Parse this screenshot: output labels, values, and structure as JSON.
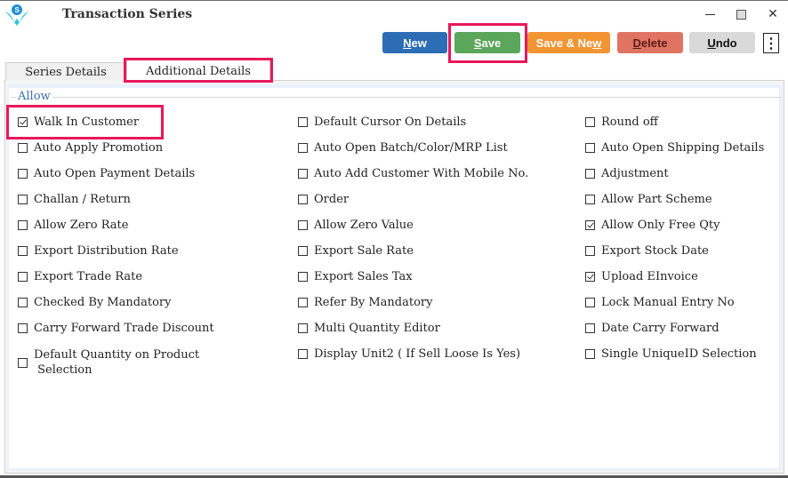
{
  "window": {
    "title": "Transaction Series",
    "controls": {
      "minimize": "—",
      "maximize": "☐",
      "close": "✕"
    }
  },
  "toolbar": {
    "new_label": "New",
    "new_accel": "N",
    "new_rest": "ew",
    "save_label": "Save",
    "save_accel": "S",
    "save_rest": "ave",
    "save_new_label": "Save & New",
    "save_new_prefix": "Save & Ne",
    "save_new_accel": "w",
    "delete_label": "Delete",
    "delete_accel": "D",
    "delete_rest": "elete",
    "undo_label": "Undo",
    "undo_accel": "U",
    "undo_rest": "ndo",
    "more_icon": "⋮",
    "colors": {
      "new": "#2d6db5",
      "save": "#5aa65a",
      "save_new": "#f39433",
      "delete": "#e07462",
      "undo": "#d9d9d9",
      "highlight": "#e8185a"
    }
  },
  "tabs": [
    {
      "label": "Series Details",
      "active": false
    },
    {
      "label": "Additional Details",
      "active": true
    }
  ],
  "group": {
    "legend": "Allow"
  },
  "options": {
    "col1": [
      {
        "label": "Walk In Customer",
        "checked": true
      },
      {
        "label": "Auto Apply Promotion",
        "checked": false
      },
      {
        "label": "Auto Open Payment Details",
        "checked": false
      },
      {
        "label": "Challan / Return",
        "checked": false
      },
      {
        "label": "Allow Zero Rate",
        "checked": false
      },
      {
        "label": "Export Distribution Rate",
        "checked": false
      },
      {
        "label": "Export Trade Rate",
        "checked": false
      },
      {
        "label": "Checked By Mandatory",
        "checked": false
      },
      {
        "label": "Carry Forward Trade Discount",
        "checked": false
      },
      {
        "label": "Default Quantity on Product",
        "label2": " Selection",
        "checked": false
      }
    ],
    "col2": [
      {
        "label": "Default Cursor On Details",
        "checked": false
      },
      {
        "label": "Auto Open Batch/Color/MRP List",
        "checked": false
      },
      {
        "label": "Auto Add Customer With Mobile No.",
        "checked": false
      },
      {
        "label": "Order",
        "checked": false
      },
      {
        "label": "Allow Zero Value",
        "checked": false
      },
      {
        "label": "Export Sale Rate",
        "checked": false
      },
      {
        "label": "Export Sales Tax",
        "checked": false
      },
      {
        "label": "Refer By Mandatory",
        "checked": false
      },
      {
        "label": "Multi Quantity Editor",
        "checked": false
      },
      {
        "label": "Display Unit2 ( If Sell Loose Is Yes)",
        "checked": false
      }
    ],
    "col3": [
      {
        "label": "Round off",
        "checked": false
      },
      {
        "label": "Auto Open Shipping Details",
        "checked": false
      },
      {
        "label": "Adjustment",
        "checked": false
      },
      {
        "label": "Allow Part Scheme",
        "checked": false
      },
      {
        "label": "Allow Only Free Qty",
        "checked": true
      },
      {
        "label": "Export Stock Date",
        "checked": false
      },
      {
        "label": "Upload EInvoice",
        "checked": true
      },
      {
        "label": "Lock Manual Entry No",
        "checked": false
      },
      {
        "label": "Date Carry Forward",
        "checked": false
      },
      {
        "label": "Single UniqueID Selection",
        "checked": false
      }
    ]
  }
}
